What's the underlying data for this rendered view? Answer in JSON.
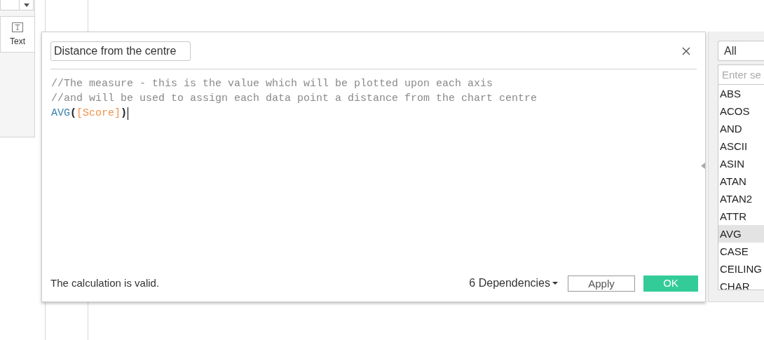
{
  "sidebar": {
    "card": {
      "label": "Text"
    }
  },
  "dialog": {
    "name_field": {
      "value": "Distance from the centre"
    },
    "code_lines": [
      [
        {
          "kind": "comment",
          "text": "//The measure - this is the value which will be plotted upon each axis"
        }
      ],
      [
        {
          "kind": "comment",
          "text": "//and will be used to assign each data point a distance from the chart centre"
        }
      ],
      [
        {
          "kind": "function",
          "text": "AVG"
        },
        {
          "kind": "paren",
          "text": "("
        },
        {
          "kind": "field",
          "text": "[Score]"
        },
        {
          "kind": "paren",
          "text": ")"
        }
      ]
    ],
    "status": "The calculation is valid.",
    "dependencies": "6 Dependencies",
    "buttons": [
      {
        "label": "Apply",
        "kind": "secondary"
      },
      {
        "label": "OK",
        "kind": "primary"
      }
    ]
  },
  "functions": {
    "filter": "All",
    "search": {
      "placeholder": "Enter se"
    },
    "items": [
      {
        "label": "ABS",
        "selected": false
      },
      {
        "label": "ACOS",
        "selected": false
      },
      {
        "label": "AND",
        "selected": false
      },
      {
        "label": "ASCII",
        "selected": false
      },
      {
        "label": "ASIN",
        "selected": false
      },
      {
        "label": "ATAN",
        "selected": false
      },
      {
        "label": "ATAN2",
        "selected": false
      },
      {
        "label": "ATTR",
        "selected": false
      },
      {
        "label": "AVG",
        "selected": true
      },
      {
        "label": "CASE",
        "selected": false
      },
      {
        "label": "CEILING",
        "selected": false
      },
      {
        "label": "CHAR",
        "selected": false
      }
    ]
  }
}
